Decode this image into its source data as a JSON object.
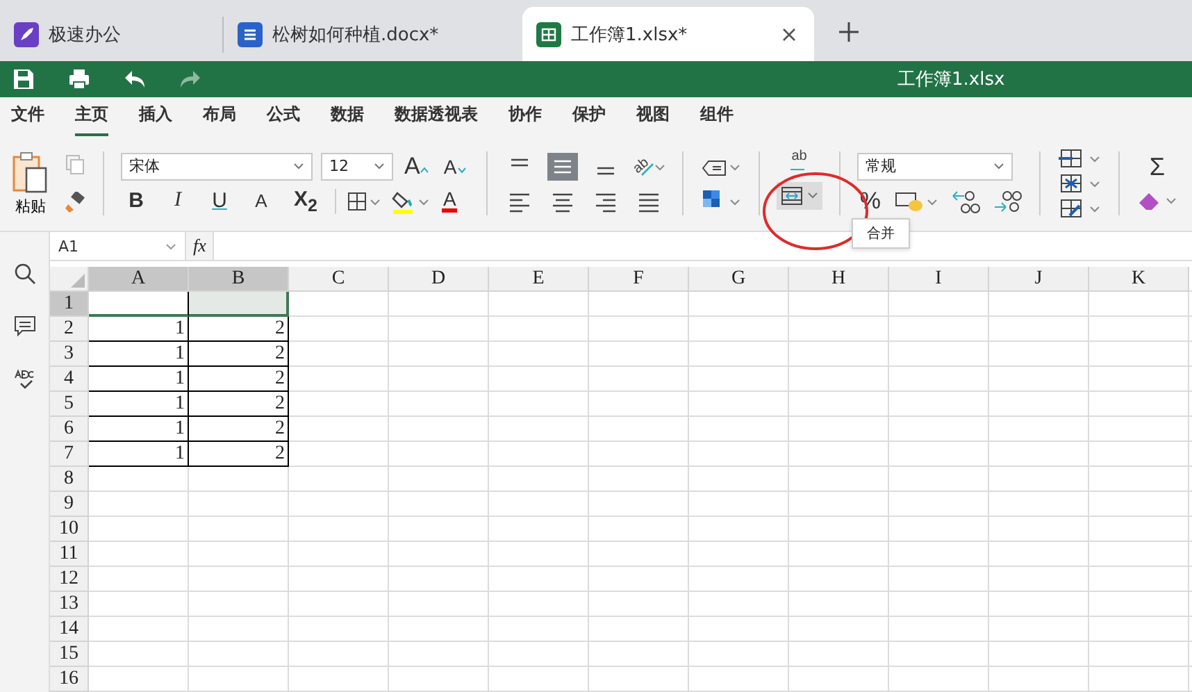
{
  "tabs": [
    {
      "kind": "app",
      "label": "极速办公",
      "selected": false
    },
    {
      "kind": "doc",
      "label": "松树如何种植.docx*",
      "selected": false
    },
    {
      "kind": "sheet",
      "label": "工作簿1.xlsx*",
      "selected": true
    }
  ],
  "window": {
    "title": "工作簿1.xlsx"
  },
  "menu": [
    {
      "label": "文件",
      "selected": false
    },
    {
      "label": "主页",
      "selected": true
    },
    {
      "label": "插入",
      "selected": false
    },
    {
      "label": "布局",
      "selected": false
    },
    {
      "label": "公式",
      "selected": false
    },
    {
      "label": "数据",
      "selected": false
    },
    {
      "label": "数据透视表",
      "selected": false
    },
    {
      "label": "协作",
      "selected": false
    },
    {
      "label": "保护",
      "selected": false
    },
    {
      "label": "视图",
      "selected": false
    },
    {
      "label": "组件",
      "selected": false
    }
  ],
  "ribbon": {
    "paste_label": "粘贴",
    "font": "宋体",
    "font_size": "12",
    "grow_label": "A",
    "shrink_label": "A",
    "format_buttons": [
      {
        "label": "B",
        "kind": "bold"
      },
      {
        "label": "I",
        "kind": "italic"
      },
      {
        "label": "U",
        "kind": "underline"
      },
      {
        "label": "A",
        "kind": "strike"
      },
      {
        "label": "X$_{2}$",
        "kind": "subscript"
      }
    ],
    "font_color_label": "A",
    "align_top": [
      {
        "selected": false
      },
      {
        "selected": true
      },
      {
        "selected": false
      }
    ],
    "orientation_label": "ab",
    "wrap_label": "ab",
    "merge_selected": true,
    "number_format": "常规",
    "percent_label": "%",
    "sum_label": "Σ",
    "tooltip": "合并"
  },
  "name_box": "A1",
  "fx_label": "fx",
  "columns": [
    {
      "label": "A",
      "selected": true
    },
    {
      "label": "B",
      "selected": true
    },
    {
      "label": "C",
      "selected": false
    },
    {
      "label": "D",
      "selected": false
    },
    {
      "label": "E",
      "selected": false
    },
    {
      "label": "F",
      "selected": false
    },
    {
      "label": "G",
      "selected": false
    },
    {
      "label": "H",
      "selected": false
    },
    {
      "label": "I",
      "selected": false
    },
    {
      "label": "J",
      "selected": false
    },
    {
      "label": "K",
      "selected": false
    }
  ],
  "rows": [
    {
      "label": "1",
      "selected": true
    },
    {
      "label": "2",
      "selected": false,
      "cells": [
        "1",
        "2"
      ]
    },
    {
      "label": "3",
      "selected": false,
      "cells": [
        "1",
        "2"
      ]
    },
    {
      "label": "4",
      "selected": false,
      "cells": [
        "1",
        "2"
      ]
    },
    {
      "label": "5",
      "selected": false,
      "cells": [
        "1",
        "2"
      ]
    },
    {
      "label": "6",
      "selected": false,
      "cells": [
        "1",
        "2"
      ]
    },
    {
      "label": "7",
      "selected": false,
      "cells": [
        "1",
        "2"
      ]
    },
    {
      "label": "8",
      "selected": false
    },
    {
      "label": "9",
      "selected": false
    },
    {
      "label": "10",
      "selected": false
    },
    {
      "label": "11",
      "selected": false
    },
    {
      "label": "12",
      "selected": false
    },
    {
      "label": "13",
      "selected": false
    },
    {
      "label": "14",
      "selected": false
    },
    {
      "label": "15",
      "selected": false
    },
    {
      "label": "16",
      "selected": false
    }
  ]
}
